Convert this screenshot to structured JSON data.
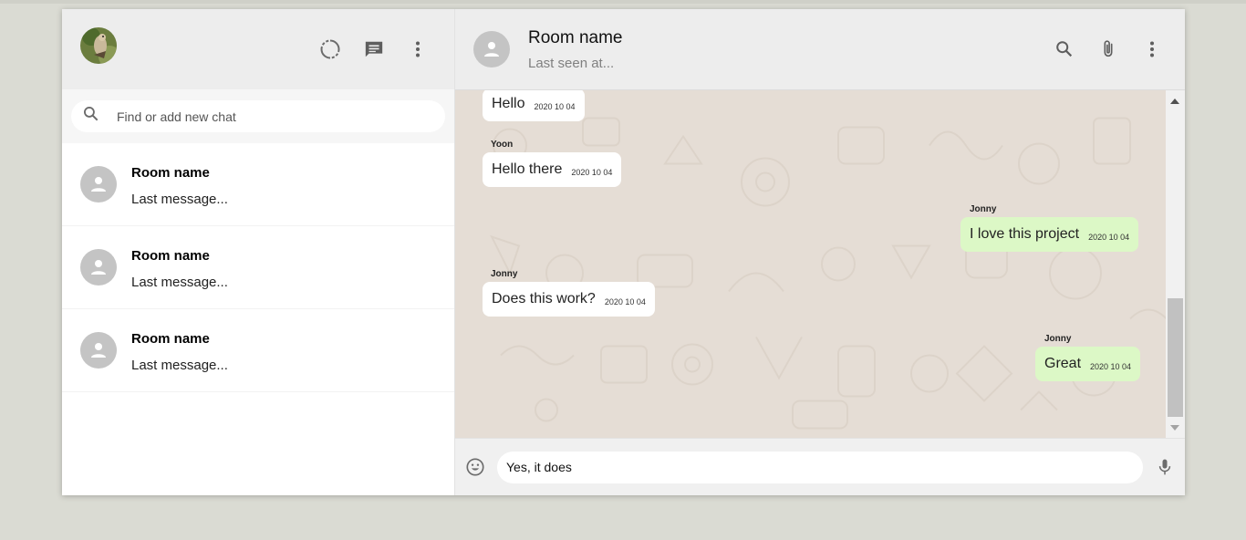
{
  "sidebar": {
    "search_placeholder": "Find or add new chat",
    "chats": [
      {
        "name": "Room name",
        "last_message": "Last message..."
      },
      {
        "name": "Room name",
        "last_message": "Last message..."
      },
      {
        "name": "Room name",
        "last_message": "Last message..."
      }
    ]
  },
  "chat": {
    "title": "Room name",
    "subtitle": "Last seen at...",
    "messages": [
      {
        "sender": "",
        "text": "Hello",
        "time": "2020 10 04",
        "sent": false
      },
      {
        "sender": "Yoon",
        "text": "Hello there",
        "time": "2020 10 04",
        "sent": false
      },
      {
        "sender": "Jonny",
        "text": "I love this project",
        "time": "2020 10 04",
        "sent": true
      },
      {
        "sender": "Jonny",
        "text": "Does this work?",
        "time": "2020 10 04",
        "sent": false
      },
      {
        "sender": "Jonny",
        "text": "Great",
        "time": "2020 10 04",
        "sent": true
      }
    ]
  },
  "composer": {
    "value": "Yes, it does"
  },
  "colors": {
    "page_bg": "#dadbd3",
    "header_bg": "#ededed",
    "chat_bg": "#e5ddd5",
    "sent_bubble": "#dcf8c6",
    "received_bubble": "#ffffff",
    "icon_gray": "#707070",
    "avatar_gray": "#c4c4c4"
  },
  "icons": {
    "status": "status-ring-icon",
    "new_chat": "chat-bubble-icon",
    "menu": "more-vert-icon",
    "search": "search-icon",
    "attach": "paperclip-icon",
    "emoji": "smiley-icon",
    "mic": "microphone-icon"
  }
}
